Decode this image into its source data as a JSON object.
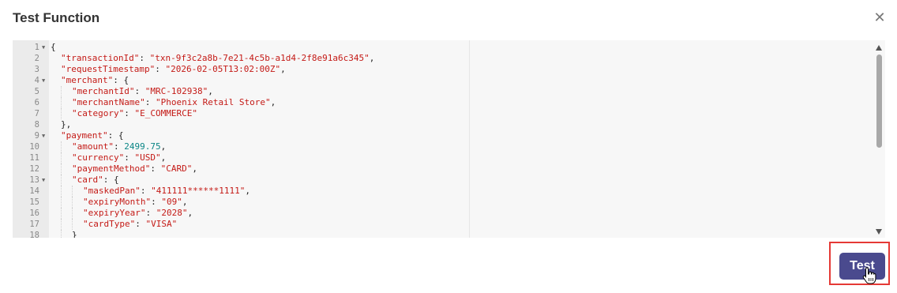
{
  "dialog": {
    "title": "Test Function",
    "close_icon": "close-icon",
    "test_button_label": "Test"
  },
  "editor": {
    "lines": [
      {
        "num": "1",
        "fold": true,
        "indent": 0,
        "parts": [
          {
            "t": "p",
            "v": "{"
          }
        ]
      },
      {
        "num": "2",
        "fold": false,
        "indent": 1,
        "parts": [
          {
            "t": "k",
            "v": "\"transactionId\""
          },
          {
            "t": "p",
            "v": ": "
          },
          {
            "t": "s",
            "v": "\"txn-9f3c2a8b-7e21-4c5b-a1d4-2f8e91a6c345\""
          },
          {
            "t": "p",
            "v": ","
          }
        ]
      },
      {
        "num": "3",
        "fold": false,
        "indent": 1,
        "parts": [
          {
            "t": "k",
            "v": "\"requestTimestamp\""
          },
          {
            "t": "p",
            "v": ": "
          },
          {
            "t": "s",
            "v": "\"2026-02-05T13:02:00Z\""
          },
          {
            "t": "p",
            "v": ","
          }
        ]
      },
      {
        "num": "4",
        "fold": true,
        "indent": 1,
        "parts": [
          {
            "t": "k",
            "v": "\"merchant\""
          },
          {
            "t": "p",
            "v": ": {"
          }
        ]
      },
      {
        "num": "5",
        "fold": false,
        "indent": 2,
        "parts": [
          {
            "t": "k",
            "v": "\"merchantId\""
          },
          {
            "t": "p",
            "v": ": "
          },
          {
            "t": "s",
            "v": "\"MRC-102938\""
          },
          {
            "t": "p",
            "v": ","
          }
        ]
      },
      {
        "num": "6",
        "fold": false,
        "indent": 2,
        "parts": [
          {
            "t": "k",
            "v": "\"merchantName\""
          },
          {
            "t": "p",
            "v": ": "
          },
          {
            "t": "s",
            "v": "\"Phoenix Retail Store\""
          },
          {
            "t": "p",
            "v": ","
          }
        ]
      },
      {
        "num": "7",
        "fold": false,
        "indent": 2,
        "parts": [
          {
            "t": "k",
            "v": "\"category\""
          },
          {
            "t": "p",
            "v": ": "
          },
          {
            "t": "s",
            "v": "\"E_COMMERCE\""
          }
        ]
      },
      {
        "num": "8",
        "fold": false,
        "indent": 1,
        "parts": [
          {
            "t": "p",
            "v": "},"
          }
        ]
      },
      {
        "num": "9",
        "fold": true,
        "indent": 1,
        "parts": [
          {
            "t": "k",
            "v": "\"payment\""
          },
          {
            "t": "p",
            "v": ": {"
          }
        ]
      },
      {
        "num": "10",
        "fold": false,
        "indent": 2,
        "parts": [
          {
            "t": "k",
            "v": "\"amount\""
          },
          {
            "t": "p",
            "v": ": "
          },
          {
            "t": "n",
            "v": "2499.75"
          },
          {
            "t": "p",
            "v": ","
          }
        ]
      },
      {
        "num": "11",
        "fold": false,
        "indent": 2,
        "parts": [
          {
            "t": "k",
            "v": "\"currency\""
          },
          {
            "t": "p",
            "v": ": "
          },
          {
            "t": "s",
            "v": "\"USD\""
          },
          {
            "t": "p",
            "v": ","
          }
        ]
      },
      {
        "num": "12",
        "fold": false,
        "indent": 2,
        "parts": [
          {
            "t": "k",
            "v": "\"paymentMethod\""
          },
          {
            "t": "p",
            "v": ": "
          },
          {
            "t": "s",
            "v": "\"CARD\""
          },
          {
            "t": "p",
            "v": ","
          }
        ]
      },
      {
        "num": "13",
        "fold": true,
        "indent": 2,
        "parts": [
          {
            "t": "k",
            "v": "\"card\""
          },
          {
            "t": "p",
            "v": ": {"
          }
        ]
      },
      {
        "num": "14",
        "fold": false,
        "indent": 3,
        "parts": [
          {
            "t": "k",
            "v": "\"maskedPan\""
          },
          {
            "t": "p",
            "v": ": "
          },
          {
            "t": "s",
            "v": "\"411111******1111\""
          },
          {
            "t": "p",
            "v": ","
          }
        ]
      },
      {
        "num": "15",
        "fold": false,
        "indent": 3,
        "parts": [
          {
            "t": "k",
            "v": "\"expiryMonth\""
          },
          {
            "t": "p",
            "v": ": "
          },
          {
            "t": "s",
            "v": "\"09\""
          },
          {
            "t": "p",
            "v": ","
          }
        ]
      },
      {
        "num": "16",
        "fold": false,
        "indent": 3,
        "parts": [
          {
            "t": "k",
            "v": "\"expiryYear\""
          },
          {
            "t": "p",
            "v": ": "
          },
          {
            "t": "s",
            "v": "\"2028\""
          },
          {
            "t": "p",
            "v": ","
          }
        ]
      },
      {
        "num": "17",
        "fold": false,
        "indent": 3,
        "parts": [
          {
            "t": "k",
            "v": "\"cardType\""
          },
          {
            "t": "p",
            "v": ": "
          },
          {
            "t": "s",
            "v": "\"VISA\""
          }
        ]
      },
      {
        "num": "18",
        "fold": false,
        "indent": 2,
        "parts": [
          {
            "t": "p",
            "v": "}"
          }
        ]
      }
    ]
  },
  "colors": {
    "button_bg": "#4a4a8e",
    "highlight_border": "#e53935",
    "string": "#c41a16",
    "number": "#0a8585"
  }
}
